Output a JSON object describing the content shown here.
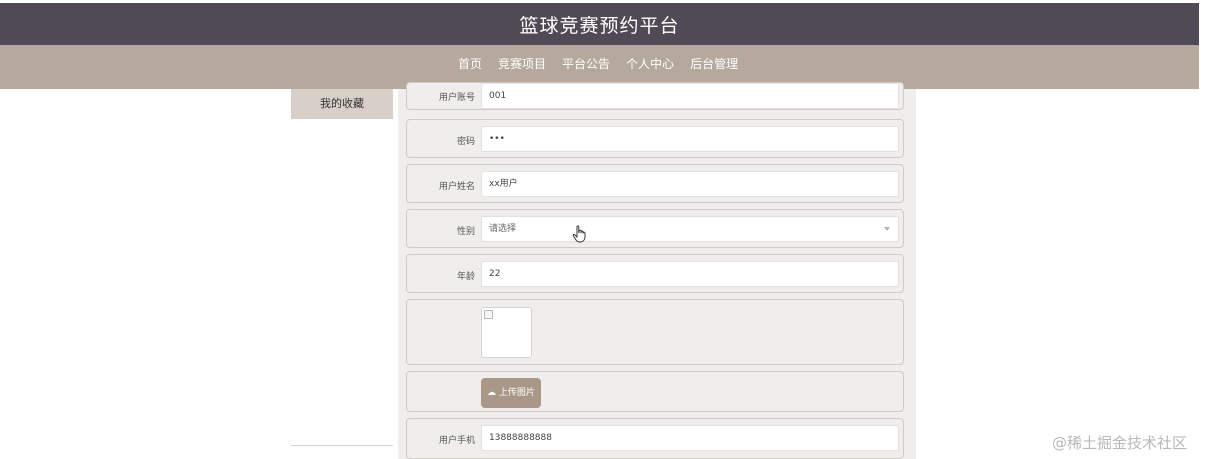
{
  "header": {
    "title": "篮球竞赛预约平台"
  },
  "nav": {
    "items": [
      {
        "label": "首页"
      },
      {
        "label": "竞赛项目"
      },
      {
        "label": "平台公告"
      },
      {
        "label": "个人中心",
        "active": true
      },
      {
        "label": "后台管理"
      }
    ]
  },
  "sidebar": {
    "items": [
      {
        "label": "我的收藏"
      }
    ]
  },
  "form": {
    "account": {
      "label": "用户账号",
      "value": "001"
    },
    "password": {
      "label": "密码",
      "value": "•••"
    },
    "name": {
      "label": "用户姓名",
      "value": "xx用户"
    },
    "gender": {
      "label": "性别",
      "placeholder": "请选择"
    },
    "age": {
      "label": "年龄",
      "value": "22"
    },
    "upload": {
      "label": "上传图片",
      "icon": "cloud-upload-icon"
    },
    "phone": {
      "label": "用户手机",
      "value": "13888888888"
    }
  },
  "watermark": "@稀土掘金技术社区",
  "colors": {
    "title_bar": "#4f4a55",
    "nav_bar": "#b5a99d",
    "upload_button": "#a99888",
    "panel": "#efeeed"
  }
}
